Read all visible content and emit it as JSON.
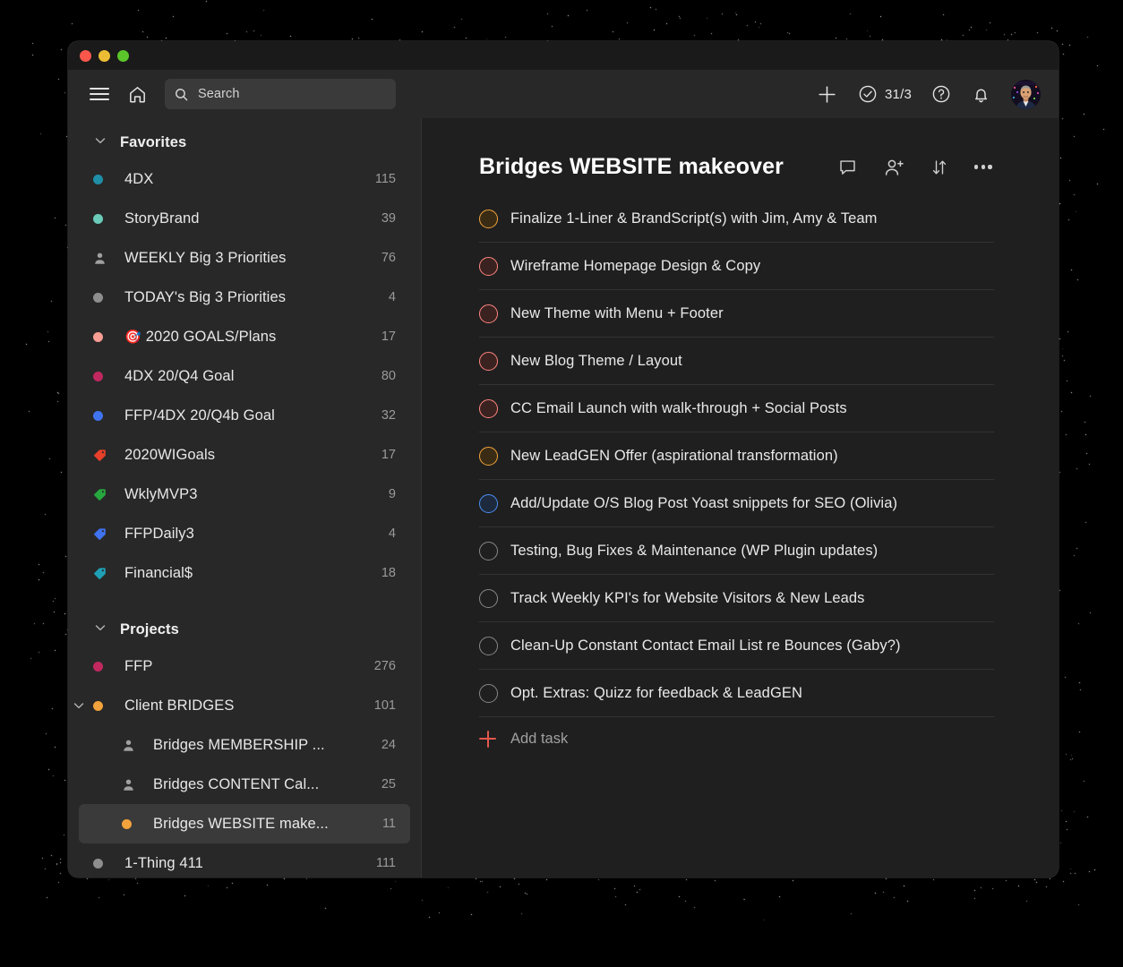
{
  "app": {
    "window_controls": [
      "close",
      "minimize",
      "maximize"
    ]
  },
  "toolbar": {
    "menu_icon": "hamburger-icon",
    "home_icon": "home-icon",
    "search": {
      "icon": "search-icon",
      "placeholder": "Search",
      "value": ""
    },
    "add_label": "+",
    "karma": {
      "icon": "check-circle-icon",
      "count": "31/3"
    },
    "help_icon": "question-circle-icon",
    "notifications_icon": "bell-icon",
    "avatar": "user-avatar"
  },
  "sidebar": {
    "favorites": {
      "title": "Favorites",
      "expanded": true,
      "items": [
        {
          "label": "4DX",
          "count": "115",
          "marker": "dot",
          "color": "#1f8fa8"
        },
        {
          "label": "StoryBrand",
          "count": "39",
          "marker": "dot",
          "color": "#6acbb9"
        },
        {
          "label": "WEEKLY Big 3 Priorities",
          "count": "76",
          "marker": "person",
          "color": "#a0a0a0"
        },
        {
          "label": "TODAY's Big 3 Priorities",
          "count": "4",
          "marker": "dot",
          "color": "#8e8e8e"
        },
        {
          "label": "2020 GOALS/Plans",
          "count": "17",
          "marker": "dot",
          "color": "#f99e94",
          "emoji": "🎯"
        },
        {
          "label": "4DX 20/Q4 Goal",
          "count": "80",
          "marker": "dot",
          "color": "#c0285f"
        },
        {
          "label": "FFP/4DX 20/Q4b Goal",
          "count": "32",
          "marker": "dot",
          "color": "#4073ef"
        },
        {
          "label": "2020WIGoals",
          "count": "17",
          "marker": "tag",
          "color": "#e8402a"
        },
        {
          "label": "WklyMVP3",
          "count": "9",
          "marker": "tag",
          "color": "#27a83f"
        },
        {
          "label": "FFPDaily3",
          "count": "4",
          "marker": "tag",
          "color": "#4073ef"
        },
        {
          "label": "Financial$",
          "count": "18",
          "marker": "tag",
          "color": "#1f9fb5"
        }
      ]
    },
    "projects": {
      "title": "Projects",
      "expanded": true,
      "items": [
        {
          "label": "FFP",
          "count": "276",
          "marker": "dot",
          "color": "#c0285f",
          "indent": 0,
          "twisty": false,
          "selected": false
        },
        {
          "label": "Client BRIDGES",
          "count": "101",
          "marker": "dot",
          "color": "#f2a33c",
          "indent": 0,
          "twisty": true,
          "selected": false
        },
        {
          "label": "Bridges MEMBERSHIP ...",
          "count": "24",
          "marker": "person",
          "color": "#a0a0a0",
          "indent": 1,
          "twisty": false,
          "selected": false
        },
        {
          "label": "Bridges CONTENT Cal...",
          "count": "25",
          "marker": "person",
          "color": "#a0a0a0",
          "indent": 1,
          "twisty": false,
          "selected": false
        },
        {
          "label": "Bridges WEBSITE make...",
          "count": "11",
          "marker": "dot",
          "color": "#f2a33c",
          "indent": 1,
          "twisty": false,
          "selected": true
        },
        {
          "label": "1-Thing 411",
          "count": "111",
          "marker": "dot",
          "color": "#8e8e8e",
          "indent": 0,
          "twisty": false,
          "selected": false
        }
      ]
    }
  },
  "main": {
    "project_title": "Bridges WEBSITE makeover",
    "actions": [
      {
        "name": "comments-icon"
      },
      {
        "name": "add-person-icon"
      },
      {
        "name": "sort-icon"
      },
      {
        "name": "more-options-icon"
      }
    ],
    "tasks": [
      {
        "text": "Finalize 1-Liner & BrandScript(s) with Jim, Amy & Team",
        "priority_color": "#f2a33c",
        "fill": "#3a2c14"
      },
      {
        "text": "Wireframe Homepage Design & Copy",
        "priority_color": "#ff8681",
        "fill": "#3a2220"
      },
      {
        "text": "New Theme with Menu + Footer",
        "priority_color": "#ff8681",
        "fill": "#3a2220"
      },
      {
        "text": "New Blog Theme / Layout",
        "priority_color": "#ff8681",
        "fill": "#3a2220"
      },
      {
        "text": "CC Email Launch with walk-through + Social Posts",
        "priority_color": "#ff8681",
        "fill": "#3a2220"
      },
      {
        "text": "New LeadGEN Offer (aspirational transformation)",
        "priority_color": "#f2a33c",
        "fill": "#3a2c14"
      },
      {
        "text": "Add/Update O/S Blog Post Yoast snippets for SEO (Olivia)",
        "priority_color": "#4a8ef0",
        "fill": "#1d2a3d"
      },
      {
        "text": "Testing, Bug Fixes & Maintenance (WP Plugin updates)",
        "priority_color": "#888888",
        "fill": "transparent"
      },
      {
        "text": "Track Weekly KPI's for Website Visitors & New Leads",
        "priority_color": "#888888",
        "fill": "transparent"
      },
      {
        "text": "Clean-Up Constant Contact Email List re Bounces (Gaby?)",
        "priority_color": "#888888",
        "fill": "transparent"
      },
      {
        "text": "Opt. Extras: Quizz for feedback & LeadGEN",
        "priority_color": "#888888",
        "fill": "transparent"
      }
    ],
    "add_task": {
      "icon": "plus-icon",
      "label": "Add task"
    }
  },
  "colors": {
    "window_bg": "#1f1f1f",
    "sidebar_bg": "#282828",
    "titlebar_bg": "#1a1a1a",
    "accent_red": "#e2584d",
    "selected_bg": "#3a3a3a",
    "divider": "#333333"
  }
}
